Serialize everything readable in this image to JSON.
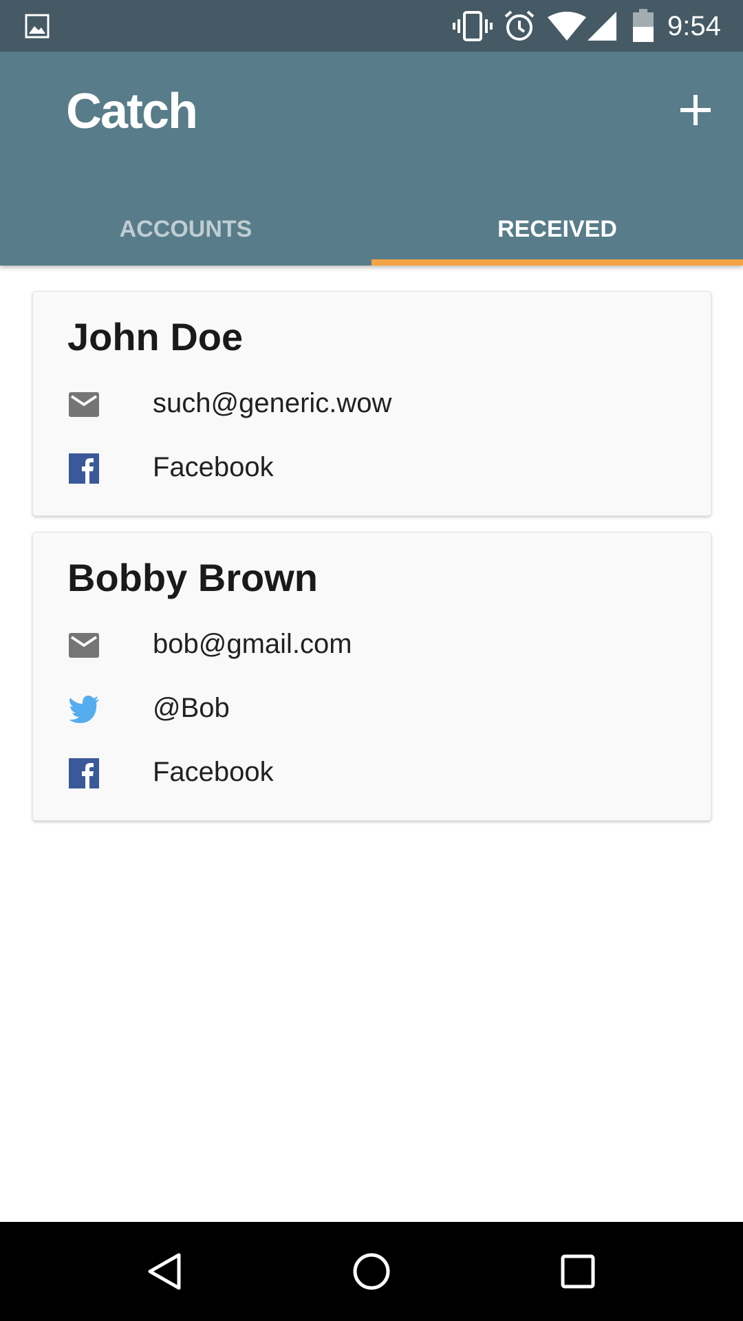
{
  "status_bar": {
    "time": "9:54",
    "icons": [
      "picture-icon",
      "vibrate-icon",
      "alarm-icon",
      "wifi-icon",
      "signal-icon",
      "battery-icon"
    ]
  },
  "app_bar": {
    "title": "Catch",
    "action_icon": "plus-icon",
    "tabs": [
      {
        "label": "ACCOUNTS",
        "selected": false
      },
      {
        "label": "RECEIVED",
        "selected": true
      }
    ],
    "colors": {
      "status_bar": "#455a64",
      "app_bar": "#587c89",
      "tab_indicator": "#f5a344"
    }
  },
  "cards": [
    {
      "name": "John Doe",
      "rows": [
        {
          "icon": "email-icon",
          "text": "such@generic.wow"
        },
        {
          "icon": "facebook-icon",
          "text": "Facebook"
        }
      ]
    },
    {
      "name": "Bobby Brown",
      "rows": [
        {
          "icon": "email-icon",
          "text": "bob@gmail.com"
        },
        {
          "icon": "twitter-icon",
          "text": "@Bob"
        },
        {
          "icon": "facebook-icon",
          "text": "Facebook"
        }
      ]
    }
  ],
  "nav_bar": {
    "icons": [
      "back-icon",
      "home-icon",
      "recents-icon"
    ]
  }
}
